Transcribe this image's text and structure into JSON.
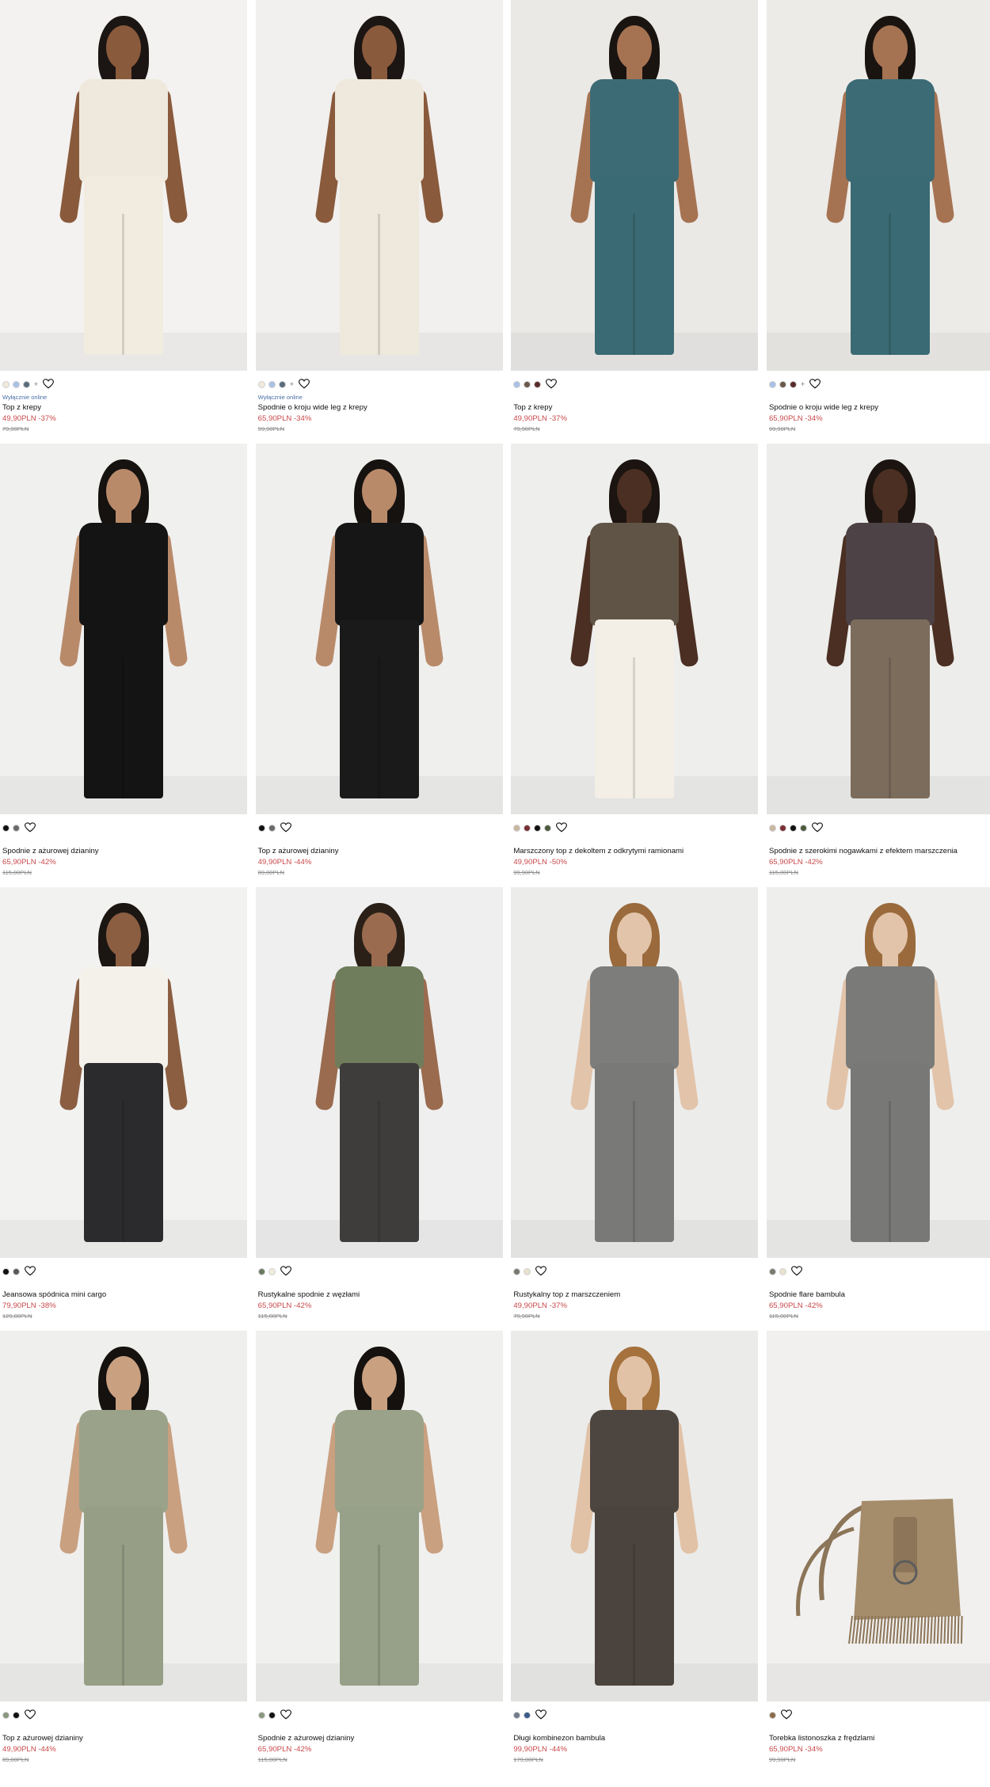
{
  "labels": {
    "online_only": "Wyłącznie online"
  },
  "products": [
    {
      "name": "Top z krepy",
      "price": "49,90PLN -37%",
      "old_price": "79,90PLN",
      "online": true,
      "swatches": [
        "#f1e9da",
        "#a9c1e8",
        "#5a6b7a"
      ],
      "more": "+",
      "bg": "#f3f2f0",
      "top": "#efe8dc",
      "bottom": "#f1ebe0",
      "skin": "#8a5a3c",
      "hairc": "#1b1513"
    },
    {
      "name": "Spodnie o kroju wide leg z krepy",
      "price": "65,90PLN -34%",
      "old_price": "99,90PLN",
      "online": true,
      "swatches": [
        "#f1e9da",
        "#a9c1e8",
        "#5a6b7a"
      ],
      "more": "+",
      "bg": "#f1f0ee",
      "top": "#efe8dc",
      "bottom": "#efe8dc",
      "skin": "#8a5a3c",
      "hairc": "#1b1513"
    },
    {
      "name": "Top z krepy",
      "price": "49,90PLN -37%",
      "old_price": "79,90PLN",
      "online": false,
      "swatches": [
        "#a9c1e8",
        "#6b5a4a",
        "#5a2a2a"
      ],
      "more": "",
      "bg": "#ebe9e6",
      "top": "#3d6b75",
      "bottom": "#3a6a73",
      "skin": "#a67352",
      "hairc": "#1a1411"
    },
    {
      "name": "Spodnie o kroju wide leg z krepy",
      "price": "65,90PLN -34%",
      "old_price": "99,90PLN",
      "online": false,
      "swatches": [
        "#a9c1e8",
        "#6b5a4a",
        "#5a2a2a"
      ],
      "more": "+",
      "bg": "#ecebe8",
      "top": "#3d6b75",
      "bottom": "#3a6a73",
      "skin": "#a67352",
      "hairc": "#1a1411"
    },
    {
      "name": "Spodnie z ażurowej dzianiny",
      "price": "65,90PLN -42%",
      "old_price": "115,00PLN",
      "online": false,
      "swatches": [
        "#111111",
        "#6a6a6a"
      ],
      "more": "",
      "bg": "#f0f0ef",
      "top": "#141414",
      "bottom": "#141414",
      "skin": "#b98a6a",
      "hairc": "#151210"
    },
    {
      "name": "Top z ażurowej dzianiny",
      "price": "49,90PLN -44%",
      "old_price": "89,00PLN",
      "online": false,
      "swatches": [
        "#111111",
        "#6a6a6a"
      ],
      "more": "",
      "bg": "#efefee",
      "top": "#161616",
      "bottom": "#1a1a1a",
      "skin": "#b98a6a",
      "hairc": "#151210"
    },
    {
      "name": "Marszczony top z dekoltem z odkrytymi ramionami",
      "price": "49,90PLN -50%",
      "old_price": "99,90PLN",
      "online": false,
      "swatches": [
        "#c9b7a0",
        "#7a2e35",
        "#111111",
        "#4e5a3e"
      ],
      "more": "",
      "bg": "#eeeeec",
      "top": "#5f5446",
      "bottom": "#f3efe6",
      "skin": "#4a2f22",
      "hairc": "#1b1410"
    },
    {
      "name": "Spodnie z szerokimi nogawkami z efektem marszczenia",
      "price": "65,90PLN -42%",
      "old_price": "115,00PLN",
      "online": false,
      "swatches": [
        "#c9b7a0",
        "#7a2e35",
        "#111111",
        "#4e5a3e"
      ],
      "more": "",
      "bg": "#ededeb",
      "top": "#4d4245",
      "bottom": "#7c6c5c",
      "skin": "#4a2f22",
      "hairc": "#1b1410"
    },
    {
      "name": "Jeansowa spódnica mini cargo",
      "price": "79,90PLN -38%",
      "old_price": "129,00PLN",
      "online": false,
      "swatches": [
        "#111111",
        "#5a5a5a"
      ],
      "more": "",
      "bg": "#f2f2f1",
      "top": "#f3f1ea",
      "bottom": "#2b2b2d",
      "skin": "#8b5e42",
      "hairc": "#1c1612"
    },
    {
      "name": "Rustykalne spodnie z węzłami",
      "price": "65,90PLN -42%",
      "old_price": "115,00PLN",
      "online": false,
      "swatches": [
        "#6b7a60",
        "#f1ecdc"
      ],
      "more": "",
      "bg": "#efefef",
      "top": "#707d5d",
      "bottom": "#3f3d3b",
      "skin": "#9a6b4f",
      "hairc": "#2a2018"
    },
    {
      "name": "Rustykalny top z marszczeniem",
      "price": "49,90PLN -37%",
      "old_price": "79,90PLN",
      "online": false,
      "swatches": [
        "#7a7a70",
        "#e8e2d0"
      ],
      "more": "",
      "bg": "#ececeb",
      "top": "#7d7d7b",
      "bottom": "#797977",
      "skin": "#e2c4aa",
      "hairc": "#9a6a3c"
    },
    {
      "name": "Spodnie flare bambula",
      "price": "65,90PLN -42%",
      "old_price": "115,00PLN",
      "online": false,
      "swatches": [
        "#7a7a70",
        "#e8e2d0"
      ],
      "more": "",
      "bg": "#eeeeed",
      "top": "#7a7a78",
      "bottom": "#787876",
      "skin": "#e2c4aa",
      "hairc": "#9a6a3c"
    },
    {
      "name": "Top z ażurowej dzianiny",
      "price": "49,90PLN -44%",
      "old_price": "89,00PLN",
      "online": false,
      "swatches": [
        "#8a9880",
        "#111111"
      ],
      "more": "",
      "bg": "#efefee",
      "top": "#9ba28a",
      "bottom": "#979e86",
      "skin": "#c9a080",
      "hairc": "#14110f"
    },
    {
      "name": "Spodnie z ażurowej dzianiny",
      "price": "65,90PLN -42%",
      "old_price": "115,00PLN",
      "online": false,
      "swatches": [
        "#8a9880",
        "#111111"
      ],
      "more": "",
      "bg": "#f0f0ef",
      "top": "#9aa289",
      "bottom": "#97a088",
      "skin": "#c9a080",
      "hairc": "#14110f"
    },
    {
      "name": "Długi kombinezon bambula",
      "price": "99,90PLN -44%",
      "old_price": "179,00PLN",
      "online": false,
      "swatches": [
        "#6e7c8a",
        "#3a5a8a"
      ],
      "more": "",
      "bg": "#ebebea",
      "top": "#4d4640",
      "bottom": "#4b443e",
      "skin": "#e1c2a6",
      "hairc": "#a5713d"
    },
    {
      "name": "Torebka listonoszka z frędzlami",
      "price": "65,90PLN -34%",
      "old_price": "99,90PLN",
      "online": false,
      "swatches": [
        "#8a6a48"
      ],
      "more": "",
      "bg": "#f1f0ef",
      "bag": "#a58d6c",
      "bagdark": "#8c7558"
    }
  ]
}
